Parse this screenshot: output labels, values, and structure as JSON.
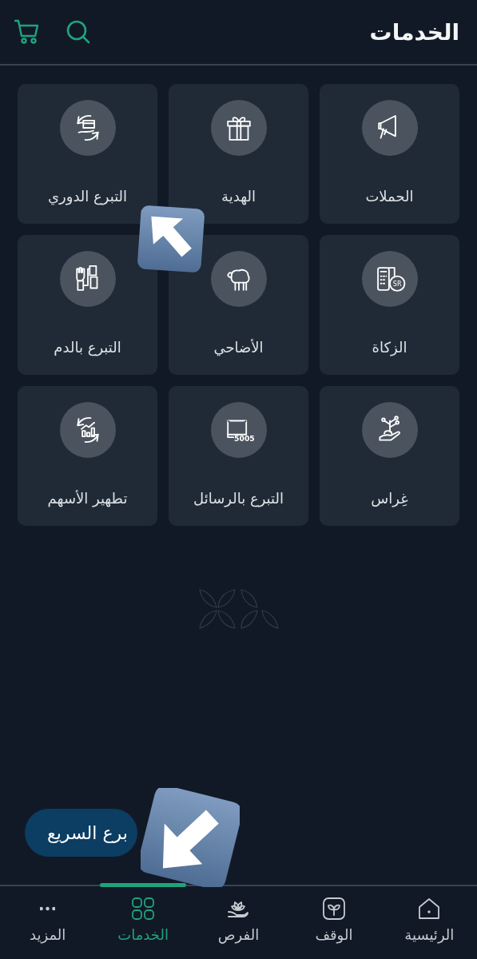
{
  "header": {
    "title": "الخدمات"
  },
  "services": [
    {
      "label": "الحملات"
    },
    {
      "label": "الهدية"
    },
    {
      "label": "التبرع الدوري"
    },
    {
      "label": "الزكاة",
      "icon_text": "SR"
    },
    {
      "label": "الأضاحي"
    },
    {
      "label": "التبرع بالدم"
    },
    {
      "label": "غِراس"
    },
    {
      "label": "التبرع بالرسائل",
      "icon_text": "5005"
    },
    {
      "label": "تطهير الأسهم"
    }
  ],
  "quick_donate_button": {
    "label": "برع السريع"
  },
  "bottom_nav": [
    {
      "label": "الرئيسية",
      "selected": false
    },
    {
      "label": "الوقف",
      "selected": false
    },
    {
      "label": "الفرص",
      "selected": false
    },
    {
      "label": "الخدمات",
      "selected": true
    },
    {
      "label": "المزيد",
      "selected": false
    }
  ]
}
